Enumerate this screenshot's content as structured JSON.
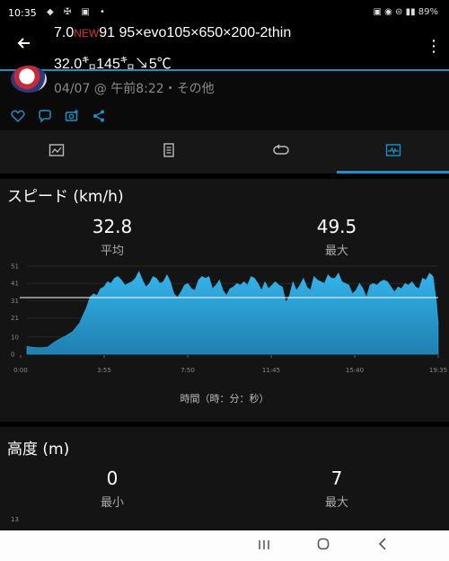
{
  "status_bar": {
    "time": "10:35",
    "left_icons": "◆ ✠ ▣ •",
    "right_icons": "▣ ◉ ⊜ ▮▮ 89%"
  },
  "header": {
    "title_prefix": "7.0",
    "title_badge": "NEW",
    "title_rest": "91 95×evo105×650×200-2thin",
    "subtitle": "32.0㌔145㌔↘5℃",
    "accent": "#1e90c8"
  },
  "activity": {
    "meta": "04/07 @ 午前8:22・その他"
  },
  "tabs": [
    {
      "icon": "overview-icon"
    },
    {
      "icon": "details-icon"
    },
    {
      "icon": "laps-icon"
    },
    {
      "icon": "charts-icon"
    }
  ],
  "speed": {
    "title": "スピード (km/h)",
    "avg_value": "32.8",
    "avg_label": "平均",
    "max_value": "49.5",
    "max_label": "最大",
    "x_axis_label": "時間（時：分：秒）"
  },
  "altitude": {
    "title": "高度 (m)",
    "min_value": "0",
    "min_label": "最小",
    "max_value": "7",
    "max_label": "最大",
    "first_tick": "13"
  },
  "chart_data": {
    "type": "area",
    "title": "スピード (km/h)",
    "xlabel": "時間（時：分：秒）",
    "ylabel": "",
    "x_ticks": [
      "0:00",
      "3:55",
      "7:50",
      "11:45",
      "15:40",
      "19:35"
    ],
    "y_ticks": [
      "0",
      "10",
      "21",
      "31",
      "41",
      "51"
    ],
    "ylim": [
      0,
      51
    ],
    "xlim_seconds": [
      0,
      1175
    ],
    "average_line": 32.8,
    "color": "#2aa8e0",
    "series": [
      {
        "x_seconds": [
          0,
          15,
          30,
          45,
          60,
          75,
          90,
          110,
          130,
          150,
          170,
          180,
          190,
          200,
          210,
          220,
          230,
          240,
          250,
          260,
          270,
          280,
          290,
          300,
          310,
          320,
          330,
          340,
          350,
          360,
          370,
          380,
          390,
          400,
          410,
          420,
          430,
          440,
          450,
          460,
          470,
          480,
          490,
          500,
          510,
          520,
          530,
          540,
          550,
          560,
          570,
          580,
          590,
          600,
          610,
          620,
          630,
          640,
          650,
          660,
          670,
          680,
          690,
          700,
          710,
          720,
          730,
          740,
          750,
          760,
          770,
          780,
          790,
          800,
          810,
          820,
          830,
          840,
          850,
          860,
          870,
          880,
          890,
          900,
          910,
          920,
          930,
          940,
          950,
          960,
          970,
          980,
          990,
          1000,
          1010,
          1020,
          1030,
          1040,
          1050,
          1060,
          1070,
          1080,
          1090,
          1100,
          1110,
          1120,
          1130,
          1140,
          1150,
          1160,
          1170,
          1175
        ],
        "values": [
          4.5,
          4.0,
          3.8,
          3.8,
          4.2,
          6.5,
          8.5,
          10.5,
          13,
          18,
          27,
          33,
          35,
          34,
          38,
          39,
          42,
          41,
          44,
          45,
          43,
          40,
          41,
          42,
          44,
          48,
          43,
          39,
          41,
          45,
          44,
          41,
          42,
          46,
          42,
          35,
          33,
          36,
          40,
          41,
          38,
          37,
          43,
          45,
          44,
          45,
          38,
          40,
          43,
          37,
          34,
          38,
          39,
          41,
          40,
          42,
          40,
          45,
          44,
          41,
          37,
          42,
          38,
          40,
          42,
          40,
          39,
          30,
          34,
          42,
          37,
          40,
          44,
          39,
          37,
          45,
          43,
          42,
          41,
          46,
          44,
          44,
          47,
          42,
          41,
          40,
          35,
          37,
          41,
          38,
          33,
          40,
          41,
          40,
          42,
          43,
          42,
          39,
          36,
          39,
          38,
          41,
          40,
          42,
          39,
          38,
          44,
          43,
          47,
          45,
          30,
          18,
          3
        ]
      }
    ]
  }
}
